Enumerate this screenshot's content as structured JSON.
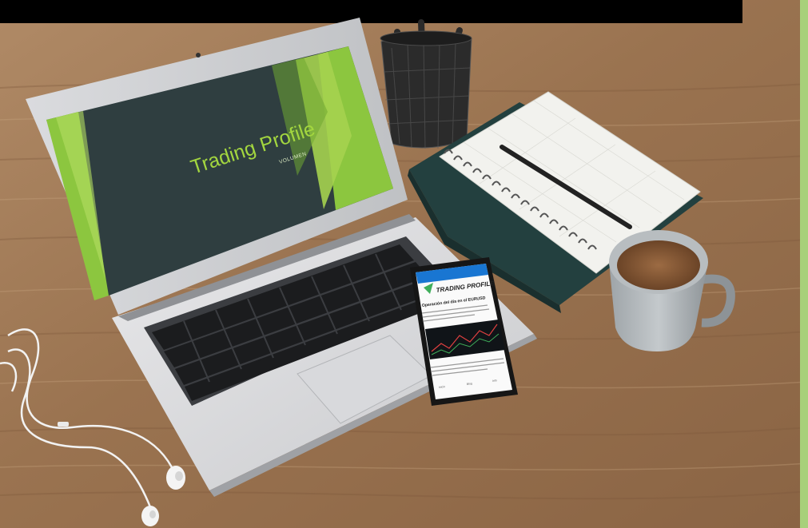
{
  "laptop": {
    "title": "Trading Profile",
    "subtitle": "VOLUMEN"
  },
  "phone": {
    "brand": "TRADING PROFILE",
    "headline": "Operación del día en el EURUSD",
    "nav_items": [
      "Inicio",
      "Blog",
      "Info"
    ]
  },
  "colors": {
    "top_banner": "#000000",
    "right_border": "#a8d07a",
    "slide_bg": "#2f3e40",
    "slide_green": "#8cc63f",
    "title_green": "#a3d63f",
    "desk_wood": "#9a7150"
  }
}
